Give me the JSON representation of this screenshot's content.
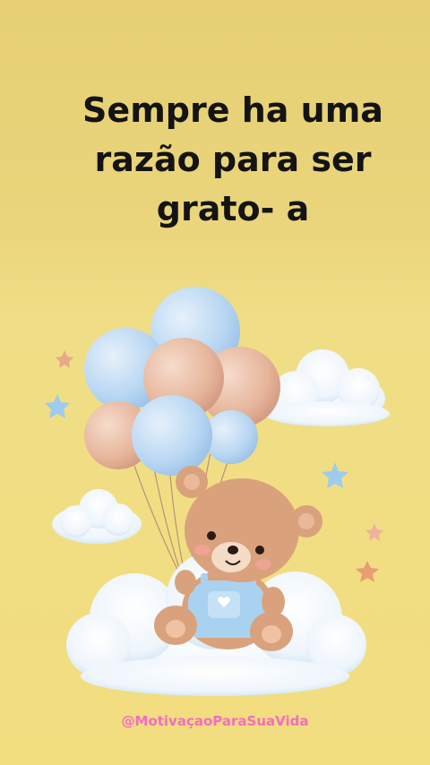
{
  "quote": {
    "lines": [
      "Sempre ha uma",
      "razão para ser",
      "grato- a"
    ]
  },
  "credit": {
    "handle": "@MotivaçaoParaSuaVida"
  },
  "illustration": {
    "subject": "teddy-bear-with-balloons-on-cloud"
  },
  "colors": {
    "background": "#ecd67d",
    "text": "#141414",
    "handle": "#f26ec0",
    "balloon_blue": "#bcd9f2",
    "balloon_peach": "#e8b9a0",
    "bear": "#d9a27c",
    "overalls": "#a9d2f0"
  }
}
